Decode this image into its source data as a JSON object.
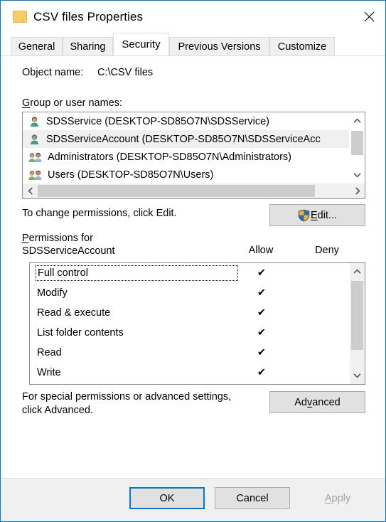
{
  "window": {
    "title": "CSV files Properties",
    "folder_icon": "folder-icon",
    "close_icon": "close-icon",
    "accent_color": "#0078d7"
  },
  "tabs": [
    {
      "label": "General",
      "active": false
    },
    {
      "label": "Sharing",
      "active": false
    },
    {
      "label": "Security",
      "active": true
    },
    {
      "label": "Previous Versions",
      "active": false
    },
    {
      "label": "Customize",
      "active": false
    }
  ],
  "security": {
    "object_name_label": "Object name:",
    "object_name_value": "C:\\CSV files",
    "group_label_accel": "G",
    "group_label_rest": "roup or user names:",
    "users": [
      {
        "name": "SDSService (DESKTOP-SD85O7N\\SDSService)",
        "icon": "user-icon",
        "selected": false
      },
      {
        "name": "SDSServiceAccount (DESKTOP-SD85O7N\\SDSServiceAcc",
        "icon": "user-icon",
        "selected": true
      },
      {
        "name": "Administrators (DESKTOP-SD85O7N\\Administrators)",
        "icon": "group-icon",
        "selected": false
      },
      {
        "name": "Users (DESKTOP-SD85O7N\\Users)",
        "icon": "group-icon",
        "selected": false
      }
    ],
    "change_permissions_text": "To change permissions, click Edit.",
    "edit_button": {
      "accel": "E",
      "rest": "dit...",
      "icon": "uac-shield-icon"
    },
    "permissions_for_line1_accel": "P",
    "permissions_for_line1_rest": "ermissions for",
    "permissions_for_line2": "SDSServiceAccount",
    "column_allow": "Allow",
    "column_deny": "Deny",
    "permissions": [
      {
        "name": "Full control",
        "allow": "✔",
        "deny": "",
        "focused": true
      },
      {
        "name": "Modify",
        "allow": "✔",
        "deny": "",
        "focused": false
      },
      {
        "name": "Read & execute",
        "allow": "✔",
        "deny": "",
        "focused": false
      },
      {
        "name": "List folder contents",
        "allow": "✔",
        "deny": "",
        "focused": false
      },
      {
        "name": "Read",
        "allow": "✔",
        "deny": "",
        "focused": false
      },
      {
        "name": "Write",
        "allow": "✔",
        "deny": "",
        "focused": false
      }
    ],
    "advanced_text_line1": "For special permissions or advanced settings,",
    "advanced_text_line2": "click Advanced.",
    "advanced_button": {
      "pre": "Ad",
      "accel": "v",
      "rest": "anced"
    }
  },
  "footer": {
    "ok": "OK",
    "cancel": "Cancel",
    "apply_accel": "A",
    "apply_rest": "pply"
  }
}
